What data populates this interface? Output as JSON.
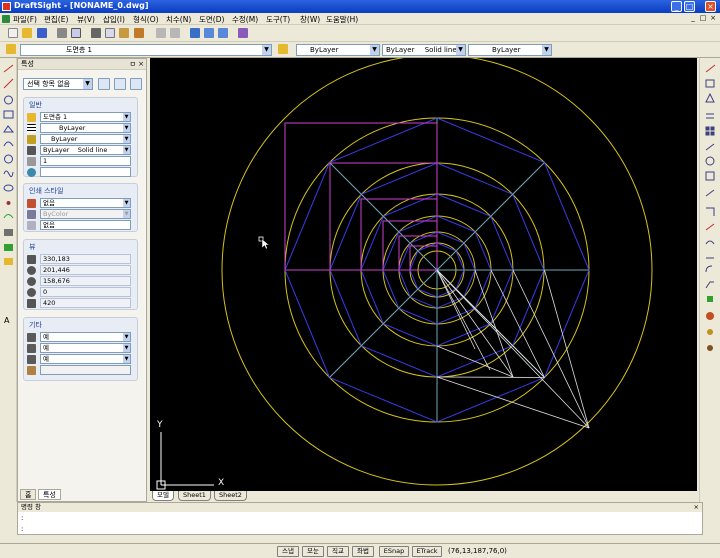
{
  "window": {
    "title": "DraftSight - [NONAME_0.dwg]",
    "controls": [
      "_",
      "□",
      "×"
    ]
  },
  "menu": {
    "items": [
      "파일(F)",
      "편집(E)",
      "뷰(V)",
      "삽입(I)",
      "형식(O)",
      "치수(N)",
      "도면(D)",
      "수정(M)",
      "도구(T)",
      "창(W)",
      "도움말(H)"
    ],
    "doc_controls": [
      "_",
      "□",
      "×"
    ]
  },
  "toolbar2": {
    "layer": "도면층 1",
    "color": "ByLayer",
    "linetype_name": "ByLayer",
    "linetype_desc": "Solid line",
    "lineweight": "ByLayer"
  },
  "panel": {
    "title": "특성",
    "selection": "선택 항목 없음",
    "general": {
      "title": "일반",
      "layer": "도면층 1",
      "linestyle": "ByLayer",
      "color": "ByLayer",
      "linetype": "ByLayer    Solid line",
      "scale": "1",
      "extra": ""
    },
    "print_style": {
      "title": "인쇄 스타일",
      "style": "없음",
      "color": "ByColor",
      "table": "없음"
    },
    "view": {
      "title": "뷰",
      "values": [
        "330,183",
        "201,446",
        "158,676",
        "0",
        "420"
      ]
    },
    "misc": {
      "title": "기타",
      "values": [
        "예",
        "예",
        "예",
        ""
      ]
    }
  },
  "panel_tabs": [
    "홈",
    "특성"
  ],
  "sheet_tabs": [
    "모델",
    "Sheet1",
    "Sheet2"
  ],
  "command": {
    "title": "명령 창",
    "lines": [
      ":",
      ":"
    ]
  },
  "status": {
    "buttons": [
      "스냅",
      "모눈",
      "직교",
      "좌법",
      "ESnap",
      "ETrack"
    ],
    "coords": "(76,13,187,76,0)"
  },
  "canvas": {
    "ucs_y": "Y",
    "ucs_x": "X"
  },
  "colors": {
    "circle": "#d6c21a",
    "blue": "#3a3ae8",
    "magenta": "#d040d0",
    "cyan": "#6fa9b8",
    "white": "#e0e0e0"
  }
}
